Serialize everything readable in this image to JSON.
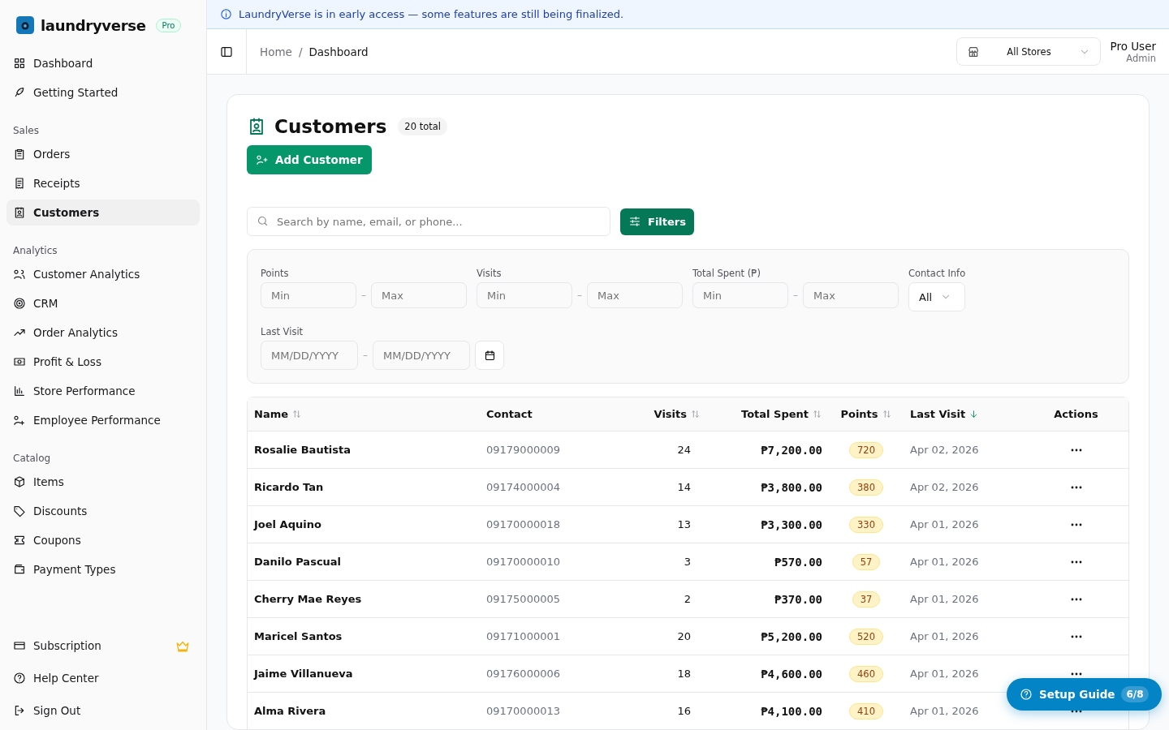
{
  "brand": {
    "name": "laundryverse",
    "badge": "Pro"
  },
  "sidebar": {
    "top": [
      {
        "label": "Dashboard",
        "selected": false
      },
      {
        "label": "Getting Started",
        "selected": false
      }
    ],
    "sections": [
      {
        "title": "Sales",
        "items": [
          {
            "label": "Orders",
            "selected": false
          },
          {
            "label": "Receipts",
            "selected": false
          },
          {
            "label": "Customers",
            "selected": true
          }
        ]
      },
      {
        "title": "Analytics",
        "items": [
          {
            "label": "Customer Analytics",
            "selected": false
          },
          {
            "label": "CRM",
            "selected": false
          },
          {
            "label": "Order Analytics",
            "selected": false
          },
          {
            "label": "Profit & Loss",
            "selected": false
          },
          {
            "label": "Store Performance",
            "selected": false
          },
          {
            "label": "Employee Performance",
            "selected": false
          }
        ]
      },
      {
        "title": "Catalog",
        "items": [
          {
            "label": "Items",
            "selected": false
          },
          {
            "label": "Discounts",
            "selected": false
          },
          {
            "label": "Coupons",
            "selected": false
          },
          {
            "label": "Payment Types",
            "selected": false
          }
        ]
      }
    ],
    "bottom": [
      {
        "label": "Subscription",
        "selected": false
      },
      {
        "label": "Help Center",
        "selected": false
      },
      {
        "label": "Sign Out",
        "selected": false
      }
    ]
  },
  "banner": "LaundryVerse is in early access — some features are still being finalized.",
  "breadcrumb": [
    "Home",
    "Dashboard"
  ],
  "breadcrumb_separator": "/",
  "store_select": {
    "value": "All Stores"
  },
  "user": {
    "name": "Pro User",
    "role": "Admin"
  },
  "page": {
    "title": "Customers",
    "count": "20 total",
    "add_button": "Add Customer"
  },
  "search": {
    "placeholder": "Search by name, email, or phone..."
  },
  "filters_button": "Filters",
  "filters": {
    "range_separator": "–",
    "ranges": [
      {
        "label": "Points",
        "min_placeholder": "Min",
        "max_placeholder": "Max"
      },
      {
        "label": "Visits",
        "min_placeholder": "Min",
        "max_placeholder": "Max"
      },
      {
        "label": "Total Spent (₱)",
        "min_placeholder": "Min",
        "max_placeholder": "Max"
      }
    ],
    "contact_info": {
      "label": "Contact Info",
      "value": "All"
    },
    "last_visit": {
      "label": "Last Visit",
      "from_placeholder": "MM/DD/YYYY",
      "to_placeholder": "MM/DD/YYYY"
    }
  },
  "table": {
    "columns": [
      {
        "label": "Name",
        "kind": "sortable",
        "sorted": false
      },
      {
        "label": "Contact",
        "kind": "plain"
      },
      {
        "label": "Visits",
        "kind": "sortable",
        "sorted": false
      },
      {
        "label": "Total Spent",
        "kind": "sortable",
        "sorted": false
      },
      {
        "label": "Points",
        "kind": "sortable",
        "sorted": false
      },
      {
        "label": "Last Visit",
        "kind": "sortable",
        "sorted": true
      },
      {
        "label": "Actions",
        "kind": "plain"
      }
    ],
    "rows": [
      {
        "name": "Rosalie Bautista",
        "contact": "09179000009",
        "visits": "24",
        "total_spent": "₱7,200.00",
        "points": "720",
        "last_visit": "Apr 02, 2026"
      },
      {
        "name": "Ricardo Tan",
        "contact": "09174000004",
        "visits": "14",
        "total_spent": "₱3,800.00",
        "points": "380",
        "last_visit": "Apr 02, 2026"
      },
      {
        "name": "Joel Aquino",
        "contact": "09170000018",
        "visits": "13",
        "total_spent": "₱3,300.00",
        "points": "330",
        "last_visit": "Apr 01, 2026"
      },
      {
        "name": "Danilo Pascual",
        "contact": "09170000010",
        "visits": "3",
        "total_spent": "₱570.00",
        "points": "57",
        "last_visit": "Apr 01, 2026"
      },
      {
        "name": "Cherry Mae Reyes",
        "contact": "09175000005",
        "visits": "2",
        "total_spent": "₱370.00",
        "points": "37",
        "last_visit": "Apr 01, 2026"
      },
      {
        "name": "Maricel Santos",
        "contact": "09171000001",
        "visits": "20",
        "total_spent": "₱5,200.00",
        "points": "520",
        "last_visit": "Apr 01, 2026"
      },
      {
        "name": "Jaime Villanueva",
        "contact": "09176000006",
        "visits": "18",
        "total_spent": "₱4,600.00",
        "points": "460",
        "last_visit": "Apr 01, 2026"
      },
      {
        "name": "Alma Rivera",
        "contact": "09170000013",
        "visits": "16",
        "total_spent": "₱4,100.00",
        "points": "410",
        "last_visit": "Apr 01, 2026"
      }
    ]
  },
  "setup_guide": {
    "label": "Setup Guide",
    "progress": "6/8"
  }
}
